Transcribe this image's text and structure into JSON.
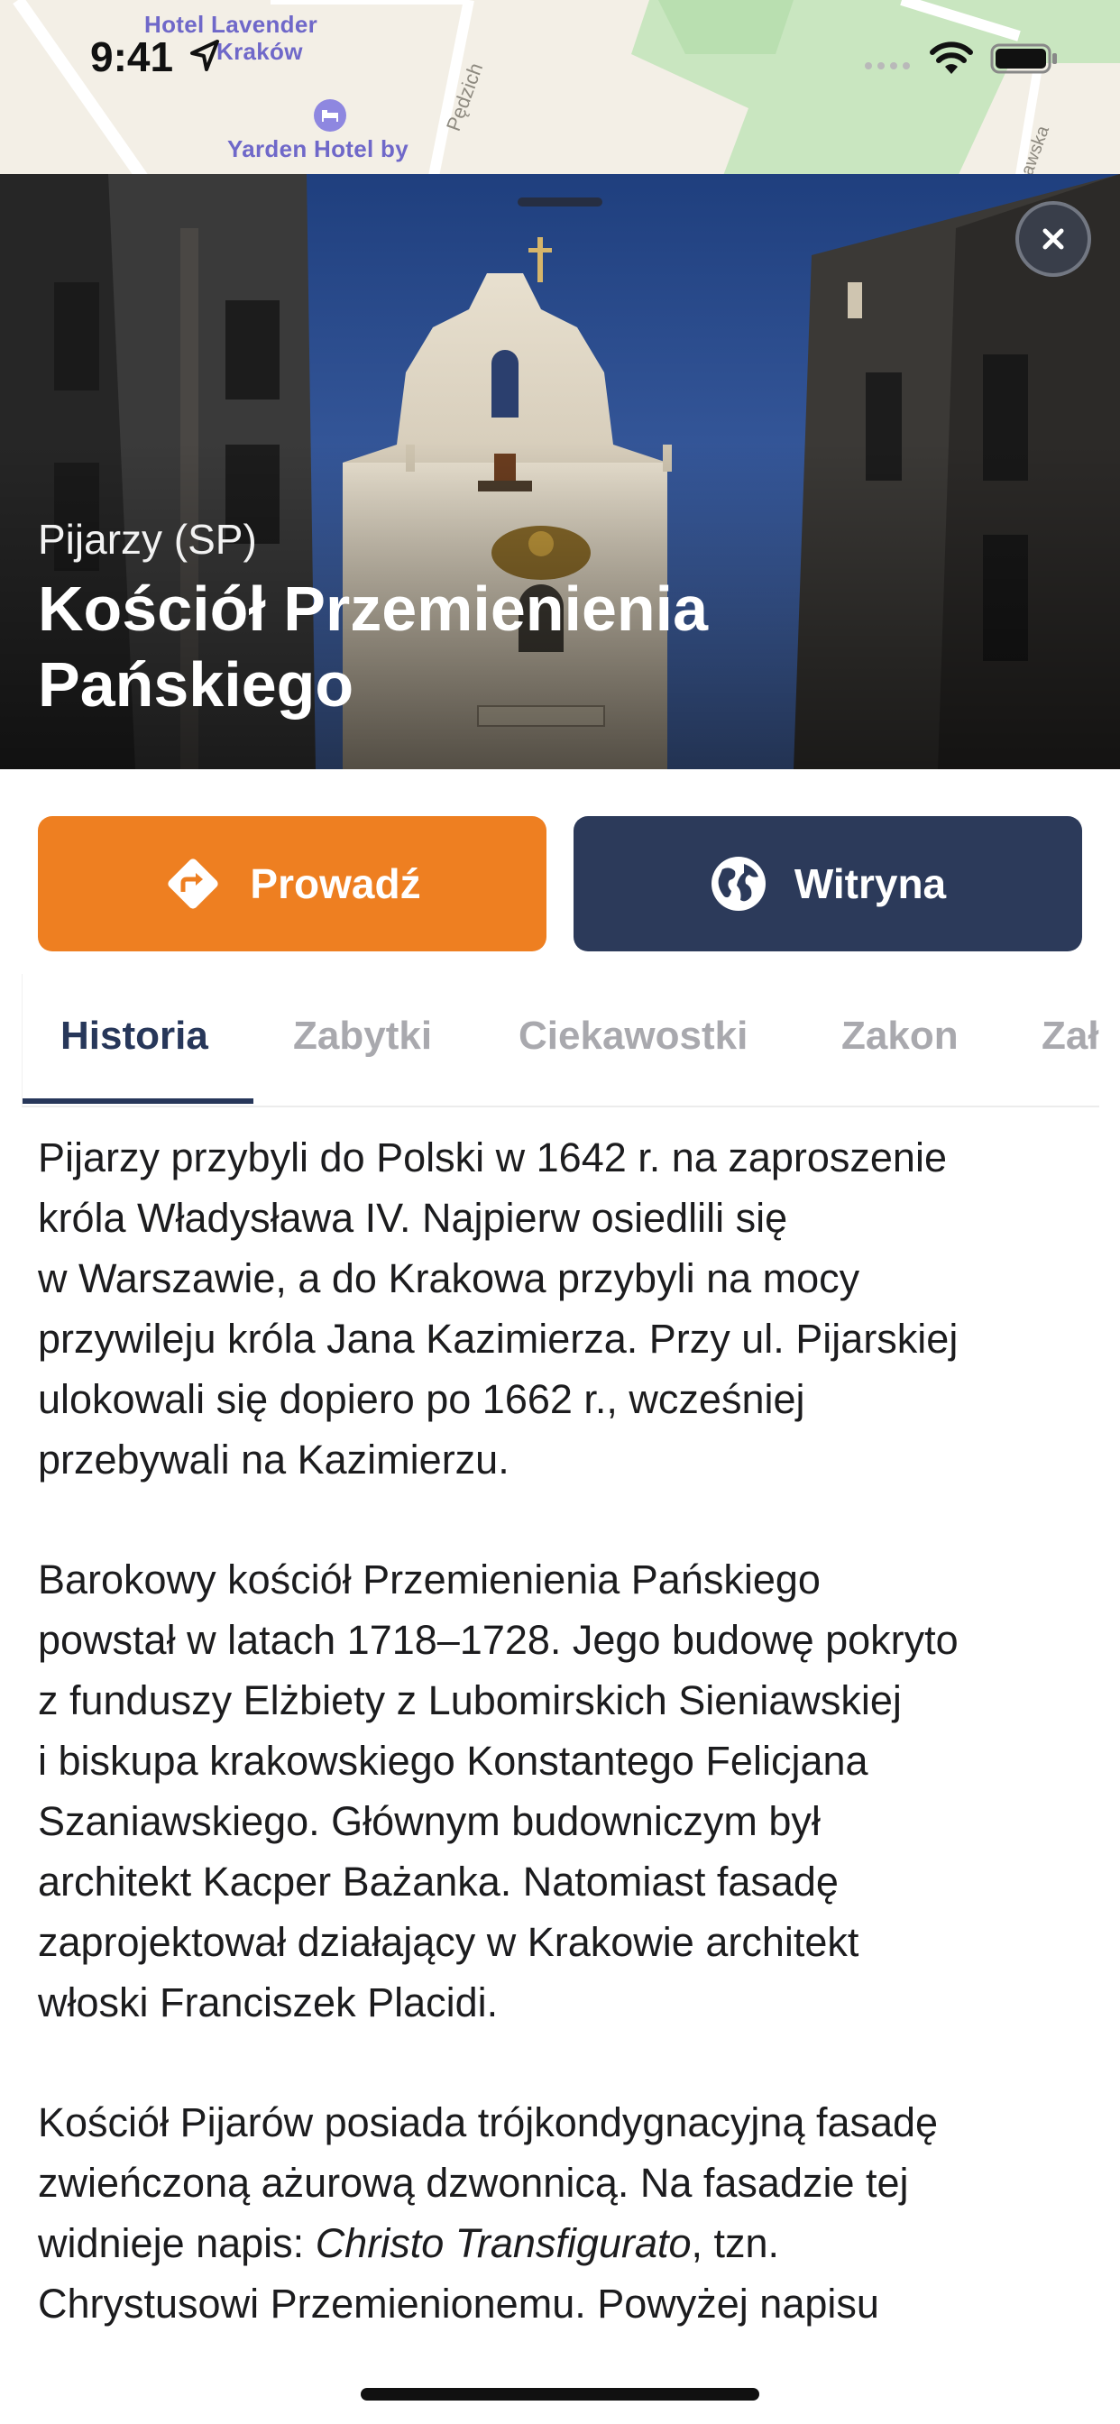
{
  "status_bar": {
    "time": "9:41"
  },
  "map": {
    "labels": {
      "hotel1_line1": "Hotel Lavender",
      "hotel1_line2": "Kraków",
      "hotel2_line1": "Yarden Hotel by",
      "street1": "Pędzich",
      "street2": "awska"
    }
  },
  "sheet": {
    "subtitle": "Pijarzy (SP)",
    "title_line1": "Kościół Przemienienia",
    "title_line2": "Pańskiego"
  },
  "actions": {
    "directions_label": "Prowadź",
    "website_label": "Witryna"
  },
  "tabs": [
    {
      "label": "Historia"
    },
    {
      "label": "Zabytki"
    },
    {
      "label": "Ciekawostki"
    },
    {
      "label": "Zakon"
    },
    {
      "label": "Zał"
    }
  ],
  "content": {
    "p1": [
      "Pijarzy przybyli do Polski w 1642 r. na zaproszenie",
      "króla Władysława IV. Najpierw osiedlili się",
      "w Warszawie, a do Krakowa przybyli na mocy",
      "przywileju króla Jana Kazimierza. Przy ul. Pijarskiej",
      "ulokowali się dopiero po 1662 r., wcześniej",
      "przebywali na Kazimierzu."
    ],
    "p2": [
      "Barokowy kościół Przemienienia Pańskiego",
      "powstał w latach 1718–1728. Jego budowę pokryto",
      "z funduszy Elżbiety z Lubomirskich Sieniawskiej",
      "i biskupa krakowskiego Konstantego Felicjana",
      "Szaniawskiego. Głównym budowniczym był",
      "architekt Kacper Bażanka. Natomiast fasadę",
      "zaprojektował działający w Krakowie architekt",
      "włoski Franciszek Placidi."
    ],
    "p3_line1": "Kościół Pijarów posiada trójkondygnacyjną fasadę",
    "p3_line2": "zwieńczoną ażurową dzwonnicą. Na fasadzie tej",
    "p3_line3_a": "widnieje napis: ",
    "p3_line3_em": "Christo Transfigurato",
    "p3_line3_b": ", tzn.",
    "p3_line4": "Chrystusowi Przemienionemu. Powyżej napisu"
  },
  "colors": {
    "directions_button": "#ee7f21",
    "website_button": "#2c3a5a",
    "active_tab": "#27375a",
    "inactive_tab": "#a9a9ae"
  },
  "icons": {
    "directions": "directions-diamond-icon",
    "website": "globe-icon",
    "close": "close-icon",
    "location": "location-arrow-icon",
    "wifi": "wifi-icon",
    "battery": "battery-icon"
  }
}
